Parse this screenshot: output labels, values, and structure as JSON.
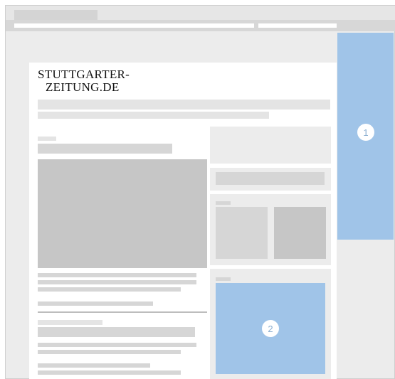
{
  "logo": {
    "line1": "STUTTGARTER-",
    "line2": "ZEITUNG.DE"
  },
  "ad_slots": [
    {
      "label": "1"
    },
    {
      "label": "2"
    }
  ],
  "colors": {
    "ad_highlight": "#a0c4e8",
    "placeholder_light": "#e4e4e4",
    "placeholder_dark": "#c6c6c6",
    "browser_frame": "#ececec"
  }
}
